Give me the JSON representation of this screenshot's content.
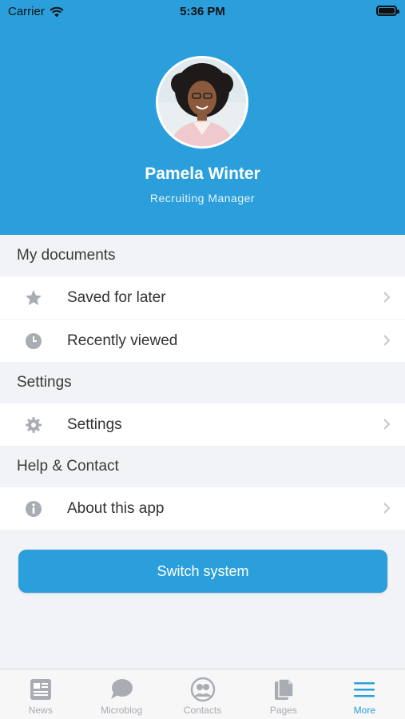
{
  "status_bar": {
    "carrier": "Carrier",
    "time": "5:36 PM",
    "wifi_icon": "wifi-icon",
    "battery_icon": "battery-icon"
  },
  "profile": {
    "name": "Pamela Winter",
    "role": "Recruiting Manager",
    "avatar": "avatar-photo"
  },
  "sections": [
    {
      "title": "My documents",
      "items": [
        {
          "label": "Saved for later",
          "icon": "star-icon"
        },
        {
          "label": "Recently viewed",
          "icon": "clock-icon"
        }
      ]
    },
    {
      "title": "Settings",
      "items": [
        {
          "label": "Settings",
          "icon": "gear-icon"
        }
      ]
    },
    {
      "title": "Help & Contact",
      "items": [
        {
          "label": "About this app",
          "icon": "info-icon"
        }
      ]
    }
  ],
  "switch_button": {
    "label": "Switch system"
  },
  "tabbar": {
    "tabs": [
      {
        "label": "News",
        "icon": "newspaper-icon",
        "active": false
      },
      {
        "label": "Microblog",
        "icon": "chat-bubble-icon",
        "active": false
      },
      {
        "label": "Contacts",
        "icon": "contacts-icon",
        "active": false
      },
      {
        "label": "Pages",
        "icon": "pages-icon",
        "active": false
      },
      {
        "label": "More",
        "icon": "menu-icon",
        "active": true
      }
    ]
  },
  "colors": {
    "accent": "#2a9fdb",
    "background": "#f2f3f7",
    "icon_gray": "#a9adb3",
    "tab_inactive": "#a7abb1"
  }
}
